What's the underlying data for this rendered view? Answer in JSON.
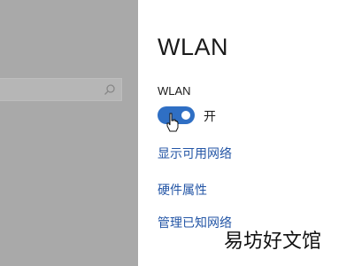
{
  "header": {
    "title": "WLAN"
  },
  "search": {
    "placeholder": ""
  },
  "wlan": {
    "label": "WLAN",
    "toggle_on": true,
    "state_text": "开"
  },
  "links": {
    "show_networks": "显示可用网络",
    "hardware_properties": "硬件属性",
    "manage_known_networks": "管理已知网络"
  },
  "watermark": {
    "text": "易坊好文馆"
  },
  "colors": {
    "accent": "#2f6fc4",
    "link": "#2456a6",
    "left_pane": "#a9a9a9"
  }
}
